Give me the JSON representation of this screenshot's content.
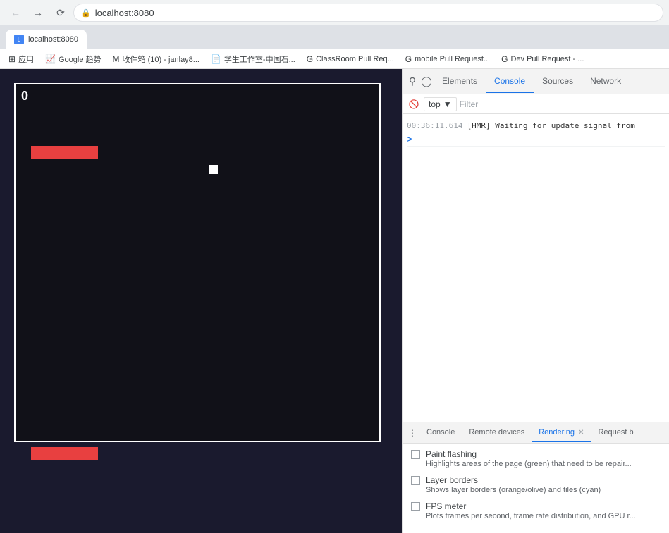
{
  "browser": {
    "address": "localhost:8080",
    "tabs": [
      {
        "label": "localhost:8080",
        "active": true,
        "favicon": "L"
      }
    ]
  },
  "bookmarks": [
    {
      "label": "应用",
      "icon": "⊞"
    },
    {
      "label": "Google 趋势",
      "icon": "📈"
    },
    {
      "label": "收件箱 (10) - janlay8...",
      "icon": "M"
    },
    {
      "label": "学生工作室-中国石...",
      "icon": "📄"
    },
    {
      "label": "ClassRoom Pull Req...",
      "icon": "G"
    },
    {
      "label": "mobile Pull Request...",
      "icon": "G"
    },
    {
      "label": "Dev Pull Request - ...",
      "icon": "G"
    }
  ],
  "game": {
    "score": "0"
  },
  "devtools": {
    "tabs": [
      "Elements",
      "Console",
      "Sources",
      "Network"
    ],
    "active_tab": "Console",
    "context": "top",
    "filter_placeholder": "Filter",
    "console_log": {
      "timestamp": "00:36:11.614",
      "message": "[HMR] Waiting for update signal from"
    }
  },
  "bottom_panel": {
    "tabs": [
      "Console",
      "Remote devices",
      "Rendering",
      "Request b"
    ],
    "active_tab": "Rendering",
    "options": [
      {
        "label": "Paint flashing",
        "desc": "Highlights areas of the page (green) that need to be repair..."
      },
      {
        "label": "Layer borders",
        "desc": "Shows layer borders (orange/olive) and tiles (cyan)"
      },
      {
        "label": "FPS meter",
        "desc": "Plots frames per second, frame rate distribution, and GPU r..."
      }
    ]
  }
}
